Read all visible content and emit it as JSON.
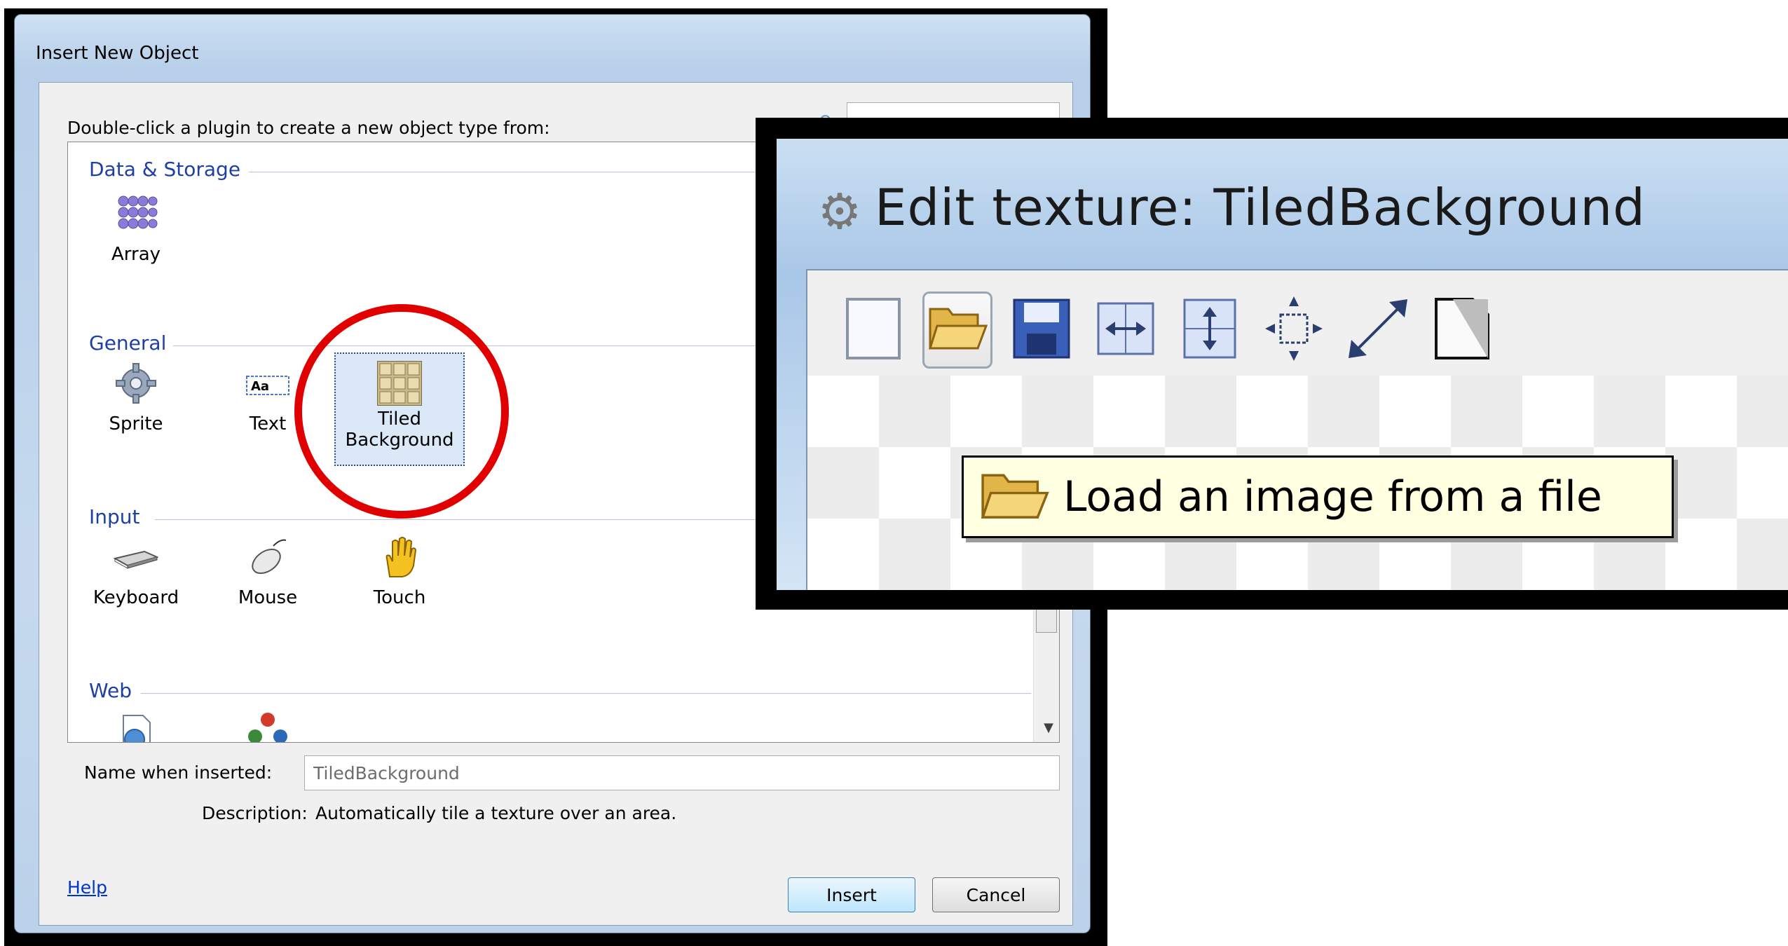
{
  "dialog": {
    "title": "Insert New Object",
    "instruction": "Double-click a plugin to create a new object type from:",
    "search": {
      "value": "",
      "icon": "search-icon"
    },
    "groups": [
      {
        "label": "Data & Storage",
        "items": [
          {
            "label": "Array",
            "icon": "array-icon"
          }
        ]
      },
      {
        "label": "General",
        "items": [
          {
            "label": "Sprite",
            "icon": "sprite-gear-icon"
          },
          {
            "label": "Text",
            "icon": "text-aa-icon"
          },
          {
            "label": "Tiled Background",
            "icon": "tiled-background-icon",
            "selected": true
          }
        ]
      },
      {
        "label": "Input",
        "items": [
          {
            "label": "Keyboard",
            "icon": "keyboard-icon"
          },
          {
            "label": "Mouse",
            "icon": "mouse-icon"
          },
          {
            "label": "Touch",
            "icon": "hand-icon"
          }
        ]
      },
      {
        "label": "Web",
        "items": [
          {
            "label": "",
            "icon": "browser-icon"
          },
          {
            "label": "",
            "icon": "social-icon"
          }
        ]
      }
    ],
    "name_label": "Name when inserted:",
    "name_value": "TiledBackground",
    "description_label": "Description:",
    "description_value": "Automatically tile a texture over an area.",
    "help_label": "Help",
    "insert_label": "Insert",
    "cancel_label": "Cancel",
    "highlight_color": "#e00000"
  },
  "zoom_window": {
    "title": "Edit texture: TiledBackground",
    "toolbar": [
      {
        "icon": "new-blank-icon"
      },
      {
        "icon": "open-folder-icon",
        "pressed": true
      },
      {
        "icon": "save-icon"
      },
      {
        "icon": "resize-horizontal-icon"
      },
      {
        "icon": "resize-vertical-icon"
      },
      {
        "icon": "crop-icon"
      },
      {
        "icon": "resize-diagonal-icon"
      },
      {
        "icon": "page-icon"
      }
    ],
    "tooltip": "Load an image from a file"
  }
}
